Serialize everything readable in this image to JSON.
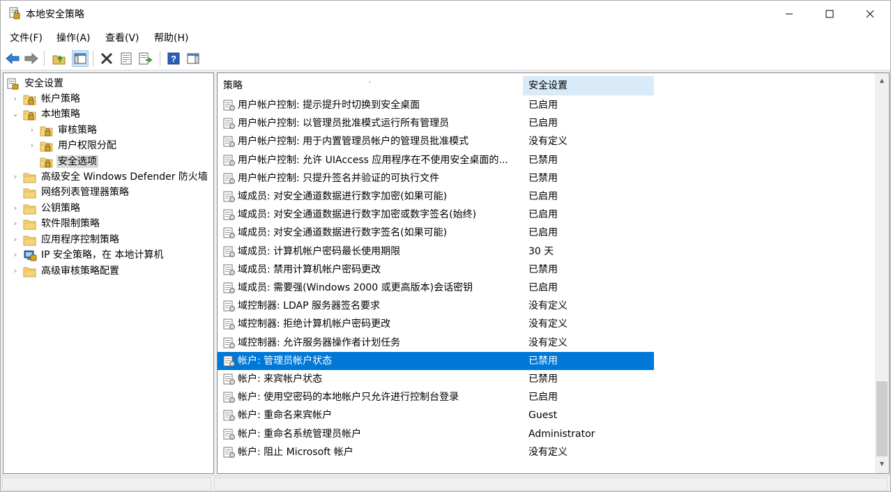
{
  "window": {
    "title": "本地安全策略",
    "controls": {
      "minimize": "─",
      "maximize": "☐",
      "close": "✕"
    }
  },
  "menu": [
    {
      "label": "文件(F)"
    },
    {
      "label": "操作(A)"
    },
    {
      "label": "查看(V)"
    },
    {
      "label": "帮助(H)"
    }
  ],
  "toolbar": {
    "buttons": [
      "back-icon",
      "forward-icon",
      "up-folder-icon",
      "show-hide-tree-icon",
      "delete-icon",
      "properties-icon",
      "export-list-icon",
      "help-icon",
      "show-action-pane-icon"
    ]
  },
  "tree": {
    "root": "安全设置",
    "items": [
      {
        "label": "帐户策略",
        "expander": "›"
      },
      {
        "label": "本地策略",
        "expander": "⌄"
      },
      {
        "label": "审核策略",
        "expander": "›"
      },
      {
        "label": "用户权限分配",
        "expander": "›"
      },
      {
        "label": "安全选项",
        "expander": ""
      },
      {
        "label": "高级安全 Windows Defender 防火墙",
        "expander": "›"
      },
      {
        "label": "网络列表管理器策略",
        "expander": ""
      },
      {
        "label": "公钥策略",
        "expander": "›"
      },
      {
        "label": "软件限制策略",
        "expander": "›"
      },
      {
        "label": "应用程序控制策略",
        "expander": "›"
      },
      {
        "label": "IP 安全策略，在 本地计算机",
        "expander": "›"
      },
      {
        "label": "高级审核策略配置",
        "expander": "›"
      }
    ]
  },
  "list": {
    "columns": {
      "policy": "策略",
      "setting": "安全设置",
      "sort_indicator": "˄"
    },
    "rows": [
      {
        "policy": "用户帐户控制: 提示提升时切换到安全桌面",
        "setting": "已启用"
      },
      {
        "policy": "用户帐户控制: 以管理员批准模式运行所有管理员",
        "setting": "已启用"
      },
      {
        "policy": "用户帐户控制: 用于内置管理员帐户的管理员批准模式",
        "setting": "没有定义"
      },
      {
        "policy": "用户帐户控制: 允许 UIAccess 应用程序在不使用安全桌面的...",
        "setting": "已禁用"
      },
      {
        "policy": "用户帐户控制: 只提升签名并验证的可执行文件",
        "setting": "已禁用"
      },
      {
        "policy": "域成员: 对安全通道数据进行数字加密(如果可能)",
        "setting": "已启用"
      },
      {
        "policy": "域成员: 对安全通道数据进行数字加密或数字签名(始终)",
        "setting": "已启用"
      },
      {
        "policy": "域成员: 对安全通道数据进行数字签名(如果可能)",
        "setting": "已启用"
      },
      {
        "policy": "域成员: 计算机帐户密码最长使用期限",
        "setting": "30 天"
      },
      {
        "policy": "域成员: 禁用计算机帐户密码更改",
        "setting": "已禁用"
      },
      {
        "policy": "域成员: 需要强(Windows 2000 或更高版本)会话密钥",
        "setting": "已启用"
      },
      {
        "policy": "域控制器: LDAP 服务器签名要求",
        "setting": "没有定义"
      },
      {
        "policy": "域控制器: 拒绝计算机帐户密码更改",
        "setting": "没有定义"
      },
      {
        "policy": "域控制器: 允许服务器操作者计划任务",
        "setting": "没有定义"
      },
      {
        "policy": "帐户: 管理员帐户状态",
        "setting": "已禁用"
      },
      {
        "policy": "帐户: 来宾帐户状态",
        "setting": "已禁用"
      },
      {
        "policy": "帐户: 使用空密码的本地帐户只允许进行控制台登录",
        "setting": "已启用"
      },
      {
        "policy": "帐户: 重命名来宾帐户",
        "setting": "Guest"
      },
      {
        "policy": "帐户: 重命名系统管理员帐户",
        "setting": "Administrator"
      },
      {
        "policy": "帐户: 阻止 Microsoft 帐户",
        "setting": "没有定义"
      }
    ]
  },
  "colors": {
    "selection": "#0078d7",
    "header_sorted": "#d9ebf9",
    "tree_selected": "#d9d9d9"
  }
}
